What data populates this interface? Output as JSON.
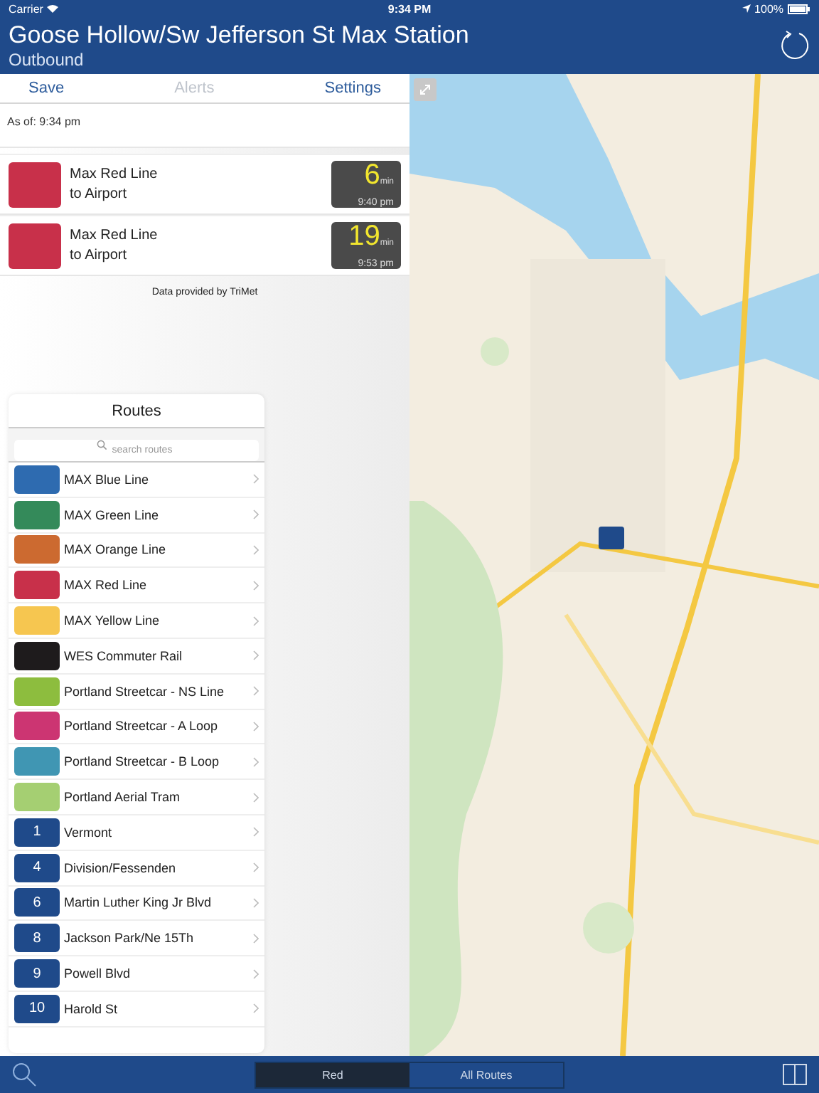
{
  "status_bar": {
    "carrier": "Carrier",
    "time": "9:34 PM",
    "battery": "100%"
  },
  "header": {
    "title": "Goose Hollow/Sw Jefferson St Max Station",
    "subtitle": "Outbound"
  },
  "toolbar": [
    {
      "label": "Save",
      "disabled": false
    },
    {
      "label": "Alerts",
      "disabled": true
    },
    {
      "label": "Settings",
      "disabled": false
    }
  ],
  "as_of": "As of: 9:34 pm",
  "arrivals": [
    {
      "color": "#c8304a",
      "route": "Max Red Line",
      "destination": "to Airport",
      "minutes": "6",
      "unit": "min",
      "time": "9:40 pm"
    },
    {
      "color": "#c8304a",
      "route": "Max Red Line",
      "destination": "to Airport",
      "minutes": "19",
      "unit": "min",
      "time": "9:53 pm"
    }
  ],
  "credit": "Data provided by TriMet",
  "routes_panel": {
    "title": "Routes",
    "search": {
      "placeholder": "search routes"
    },
    "routes": [
      {
        "kind": "color",
        "color": "#2e6bb0",
        "name": "MAX Blue Line"
      },
      {
        "kind": "color",
        "color": "#348a5a",
        "name": "MAX Green Line"
      },
      {
        "kind": "color",
        "color": "#cc6a30",
        "name": "MAX Orange Line"
      },
      {
        "kind": "color",
        "color": "#c8304a",
        "name": "MAX Red Line"
      },
      {
        "kind": "color",
        "color": "#f6c650",
        "name": "MAX Yellow Line"
      },
      {
        "kind": "color",
        "color": "#1e1b1c",
        "name": "WES Commuter Rail"
      },
      {
        "kind": "color",
        "color": "#8dbd3e",
        "name": "Portland Streetcar - NS Line"
      },
      {
        "kind": "color",
        "color": "#cc3572",
        "name": "Portland Streetcar - A Loop"
      },
      {
        "kind": "color",
        "color": "#4096b3",
        "name": "Portland Streetcar - B Loop"
      },
      {
        "kind": "color",
        "color": "#a5cf72",
        "name": "Portland Aerial Tram"
      },
      {
        "kind": "number",
        "number": "1",
        "name": "Vermont"
      },
      {
        "kind": "number",
        "number": "4",
        "name": "Division/Fessenden"
      },
      {
        "kind": "number",
        "number": "6",
        "name": "Martin Luther King Jr Blvd"
      },
      {
        "kind": "number",
        "number": "8",
        "name": "Jackson Park/Ne 15Th"
      },
      {
        "kind": "number",
        "number": "9",
        "name": "Powell Blvd"
      },
      {
        "kind": "number",
        "number": "10",
        "name": "Harold St"
      }
    ]
  },
  "bottom_bar": {
    "segments": [
      {
        "label": "Red",
        "selected": true
      },
      {
        "label": "All Routes",
        "selected": false
      }
    ]
  }
}
